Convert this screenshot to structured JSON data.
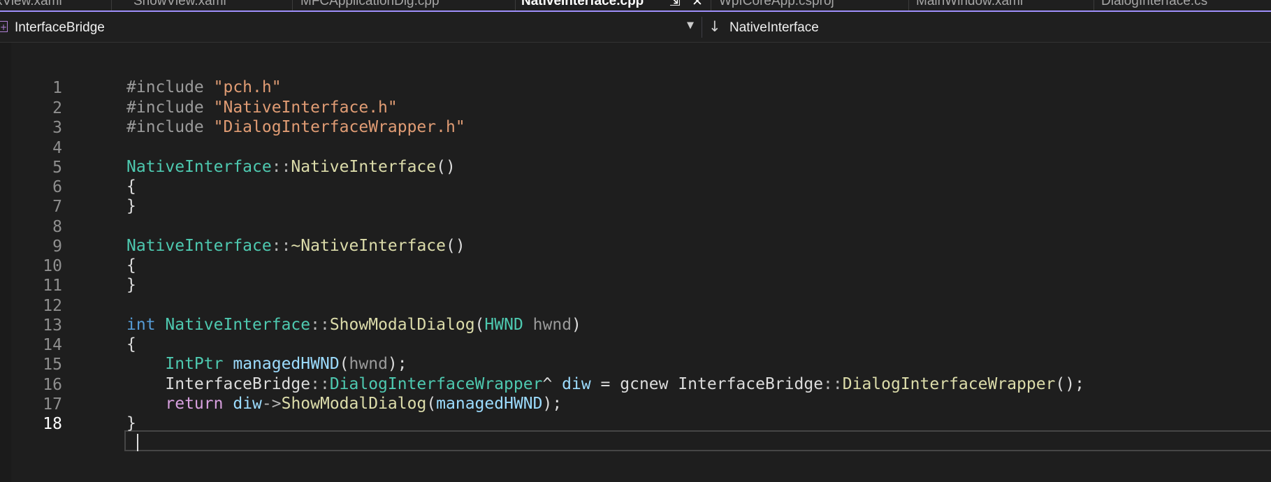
{
  "tabs": [
    {
      "label": "xView.xaml",
      "active": false
    },
    {
      "label": "ShowView.xaml",
      "active": false
    },
    {
      "label": "MFCApplicationDlg.cpp",
      "active": false
    },
    {
      "label": "NativeInterface.cpp",
      "active": true
    },
    {
      "label": "WpfCoreApp.csproj",
      "active": false
    },
    {
      "label": "MainWindow.xaml",
      "active": false
    },
    {
      "label": "DialogInterface.cs",
      "active": false
    }
  ],
  "navbar": {
    "project_icon": "cpp-project-icon",
    "project": "InterfaceBridge",
    "dropdown_icon": "chevron-down-icon",
    "member_icon": "arrow-down-icon",
    "member": "NativeInterface"
  },
  "editor": {
    "current_line": 18,
    "lines": [
      {
        "n": "1",
        "text": "#include \"pch.h\""
      },
      {
        "n": "2",
        "text": "#include \"NativeInterface.h\""
      },
      {
        "n": "3",
        "text": "#include \"DialogInterfaceWrapper.h\""
      },
      {
        "n": "4",
        "text": ""
      },
      {
        "n": "5",
        "text": "NativeInterface::NativeInterface()"
      },
      {
        "n": "6",
        "text": "{"
      },
      {
        "n": "7",
        "text": "}"
      },
      {
        "n": "8",
        "text": ""
      },
      {
        "n": "9",
        "text": "NativeInterface::~NativeInterface()"
      },
      {
        "n": "10",
        "text": "{"
      },
      {
        "n": "11",
        "text": "}"
      },
      {
        "n": "12",
        "text": ""
      },
      {
        "n": "13",
        "text": "int NativeInterface::ShowModalDialog(HWND hwnd)"
      },
      {
        "n": "14",
        "text": "{"
      },
      {
        "n": "15",
        "text": "    IntPtr managedHWND(hwnd);"
      },
      {
        "n": "16",
        "text": "    InterfaceBridge::DialogInterfaceWrapper^ diw = gcnew InterfaceBridge::DialogInterfaceWrapper();"
      },
      {
        "n": "17",
        "text": "    return diw->ShowModalDialog(managedHWND);"
      },
      {
        "n": "18",
        "text": "}"
      }
    ]
  },
  "colors": {
    "background": "#1e1e1e",
    "tab_accent": "#9f8ffb",
    "keyword": "#569cd6",
    "type": "#4ec9b0",
    "function": "#dcdcaa",
    "string": "#e09c74",
    "variable": "#9cdcfe",
    "control": "#d8a0df"
  }
}
